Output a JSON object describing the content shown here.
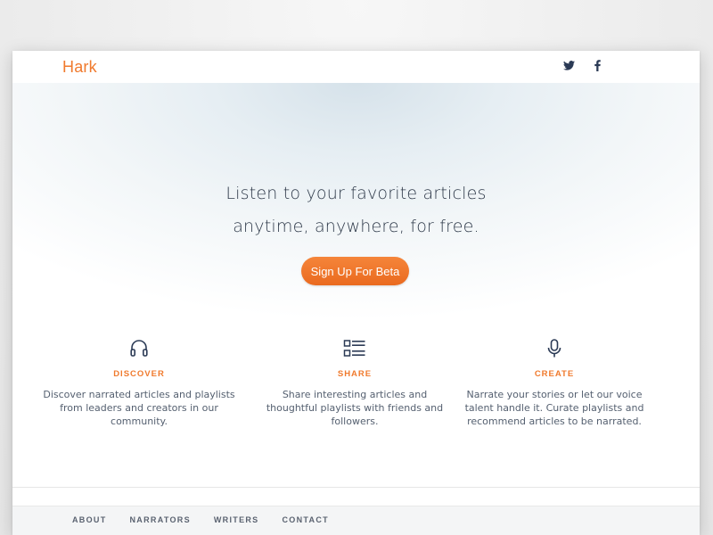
{
  "header": {
    "logo_text": "Hark",
    "social": [
      {
        "name": "twitter",
        "icon": "twitter-icon"
      },
      {
        "name": "facebook",
        "icon": "facebook-icon"
      }
    ]
  },
  "hero": {
    "line1": "Listen to your favorite articles",
    "line2": "anytime, anywhere, for free.",
    "cta_label": "Sign Up For Beta"
  },
  "features": [
    {
      "icon": "headphones-icon",
      "title": "DISCOVER",
      "description": "Discover narrated articles and playlists from leaders and creators in our community."
    },
    {
      "icon": "list-icon",
      "title": "SHARE",
      "description": "Share interesting articles and thoughtful playlists with friends and followers."
    },
    {
      "icon": "microphone-icon",
      "title": "CREATE",
      "description": "Narrate your stories or let our voice talent handle it. Curate playlists and recommend articles to be narrated."
    }
  ],
  "footer": {
    "links": [
      "ABOUT",
      "NARRATORS",
      "WRITERS",
      "CONTACT"
    ]
  },
  "colors": {
    "accent": "#f07a2d",
    "text_dark": "#2f3a4a",
    "icon_navy": "#2b3a55"
  }
}
